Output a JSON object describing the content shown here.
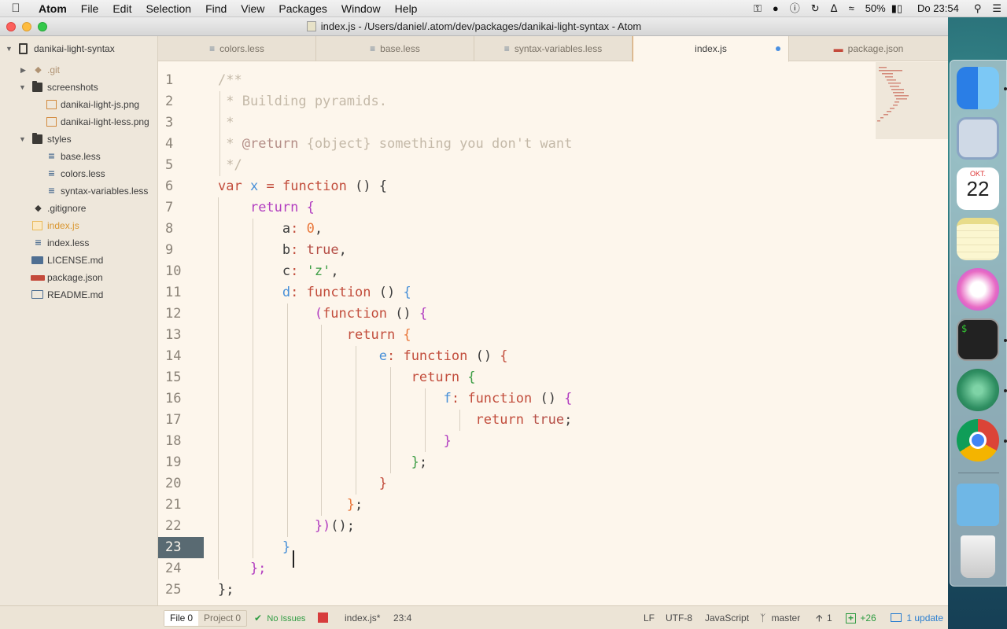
{
  "menubar": {
    "app": "Atom",
    "items": [
      "File",
      "Edit",
      "Selection",
      "Find",
      "View",
      "Packages",
      "Window",
      "Help"
    ],
    "battery": "50%",
    "clock": "Do 23:54"
  },
  "window": {
    "title": "index.js - /Users/daniel/.atom/dev/packages/danikai-light-syntax - Atom"
  },
  "tree": {
    "root": "danikai-light-syntax",
    "items": [
      {
        "label": ".git",
        "type": "folder-git",
        "depth": 1,
        "expanded": false
      },
      {
        "label": "screenshots",
        "type": "folder",
        "depth": 1,
        "expanded": true
      },
      {
        "label": "danikai-light-js.png",
        "type": "image",
        "depth": 2
      },
      {
        "label": "danikai-light-less.png",
        "type": "image",
        "depth": 2
      },
      {
        "label": "styles",
        "type": "folder",
        "depth": 1,
        "expanded": true
      },
      {
        "label": "base.less",
        "type": "less",
        "depth": 2
      },
      {
        "label": "colors.less",
        "type": "less",
        "depth": 2
      },
      {
        "label": "syntax-variables.less",
        "type": "less",
        "depth": 2
      },
      {
        "label": ".gitignore",
        "type": "git",
        "depth": 1
      },
      {
        "label": "index.js",
        "type": "js",
        "depth": 1,
        "highlight": true
      },
      {
        "label": "index.less",
        "type": "less",
        "depth": 1
      },
      {
        "label": "LICENSE.md",
        "type": "md",
        "depth": 1
      },
      {
        "label": "package.json",
        "type": "npm",
        "depth": 1
      },
      {
        "label": "README.md",
        "type": "book",
        "depth": 1
      }
    ]
  },
  "tabs": [
    {
      "label": "colors.less",
      "icon": "less"
    },
    {
      "label": "base.less",
      "icon": "less"
    },
    {
      "label": "syntax-variables.less",
      "icon": "less"
    },
    {
      "label": "index.js",
      "icon": "js",
      "active": true,
      "modified": true
    },
    {
      "label": "package.json",
      "icon": "npm"
    }
  ],
  "editor": {
    "current_line": 23,
    "line_numbers": [
      "1",
      "2",
      "3",
      "4",
      "5",
      "6",
      "7",
      "8",
      "9",
      "10",
      "11",
      "12",
      "13",
      "14",
      "15",
      "16",
      "17",
      "18",
      "19",
      "20",
      "21",
      "22",
      "23",
      "24",
      "25"
    ],
    "lines": [
      [
        {
          "t": "/**",
          "c": "comment"
        }
      ],
      [
        {
          "t": " * Building pyramids.",
          "c": "comment"
        }
      ],
      [
        {
          "t": " *",
          "c": "comment"
        }
      ],
      [
        {
          "t": " * ",
          "c": "comment"
        },
        {
          "t": "@return",
          "c": "doc"
        },
        {
          "t": " {object} something you don't want",
          "c": "comment"
        }
      ],
      [
        {
          "t": " */",
          "c": "comment"
        }
      ],
      [
        {
          "t": "var",
          "c": "kw"
        },
        {
          "t": " ",
          "c": ""
        },
        {
          "t": "x",
          "c": "var"
        },
        {
          "t": " ",
          "c": ""
        },
        {
          "t": "=",
          "c": "op"
        },
        {
          "t": " ",
          "c": ""
        },
        {
          "t": "function",
          "c": "kw"
        },
        {
          "t": " () {",
          "c": ""
        }
      ],
      [
        {
          "t": "    ",
          "c": ""
        },
        {
          "t": "return",
          "c": "ret"
        },
        {
          "t": " {",
          "c": "ret"
        }
      ],
      [
        {
          "t": "        a",
          "c": ""
        },
        {
          "t": ":",
          "c": "op"
        },
        {
          "t": " ",
          "c": ""
        },
        {
          "t": "0",
          "c": "num"
        },
        {
          "t": ",",
          "c": ""
        }
      ],
      [
        {
          "t": "        b",
          "c": ""
        },
        {
          "t": ":",
          "c": "op"
        },
        {
          "t": " ",
          "c": ""
        },
        {
          "t": "true",
          "c": "bool"
        },
        {
          "t": ",",
          "c": ""
        }
      ],
      [
        {
          "t": "        c",
          "c": ""
        },
        {
          "t": ":",
          "c": "op"
        },
        {
          "t": " ",
          "c": ""
        },
        {
          "t": "'z'",
          "c": "str"
        },
        {
          "t": ",",
          "c": ""
        }
      ],
      [
        {
          "t": "        ",
          "c": ""
        },
        {
          "t": "d",
          "c": "var"
        },
        {
          "t": ":",
          "c": "op"
        },
        {
          "t": " ",
          "c": ""
        },
        {
          "t": "function",
          "c": "kw"
        },
        {
          "t": " () ",
          "c": ""
        },
        {
          "t": "{",
          "c": "var"
        }
      ],
      [
        {
          "t": "            (",
          "c": "ret"
        },
        {
          "t": "function",
          "c": "kw"
        },
        {
          "t": " () ",
          "c": ""
        },
        {
          "t": "{",
          "c": "ret"
        }
      ],
      [
        {
          "t": "                ",
          "c": ""
        },
        {
          "t": "return",
          "c": "kw"
        },
        {
          "t": " {",
          "c": "num"
        }
      ],
      [
        {
          "t": "                    ",
          "c": ""
        },
        {
          "t": "e",
          "c": "var"
        },
        {
          "t": ":",
          "c": "op"
        },
        {
          "t": " ",
          "c": ""
        },
        {
          "t": "function",
          "c": "kw"
        },
        {
          "t": " () ",
          "c": ""
        },
        {
          "t": "{",
          "c": "kw"
        }
      ],
      [
        {
          "t": "                        ",
          "c": ""
        },
        {
          "t": "return",
          "c": "kw"
        },
        {
          "t": " {",
          "c": "str"
        }
      ],
      [
        {
          "t": "                            ",
          "c": ""
        },
        {
          "t": "f",
          "c": "var"
        },
        {
          "t": ":",
          "c": "op"
        },
        {
          "t": " ",
          "c": ""
        },
        {
          "t": "function",
          "c": "kw"
        },
        {
          "t": " () ",
          "c": ""
        },
        {
          "t": "{",
          "c": "ret"
        }
      ],
      [
        {
          "t": "                                ",
          "c": ""
        },
        {
          "t": "return",
          "c": "kw"
        },
        {
          "t": " ",
          "c": ""
        },
        {
          "t": "true",
          "c": "bool"
        },
        {
          "t": ";",
          "c": ""
        }
      ],
      [
        {
          "t": "                            }",
          "c": "ret"
        }
      ],
      [
        {
          "t": "                        }",
          "c": "str"
        },
        {
          "t": ";",
          "c": ""
        }
      ],
      [
        {
          "t": "                    }",
          "c": "kw"
        }
      ],
      [
        {
          "t": "                }",
          "c": "num"
        },
        {
          "t": ";",
          "c": ""
        }
      ],
      [
        {
          "t": "            })",
          "c": "ret"
        },
        {
          "t": "();",
          "c": ""
        }
      ],
      [
        {
          "t": "        }",
          "c": "var"
        }
      ],
      [
        {
          "t": "    };",
          "c": "ret"
        }
      ],
      [
        {
          "t": "};",
          "c": ""
        }
      ]
    ]
  },
  "statusbar": {
    "file_tab": "File",
    "file_count": "0",
    "project_tab": "Project",
    "project_count": "0",
    "no_issues": "No Issues",
    "file_name": "index.js*",
    "cursor_pos": "23:4",
    "line_ending": "LF",
    "encoding": "UTF-8",
    "grammar": "JavaScript",
    "branch": "master",
    "ahead": "1",
    "additions": "+26",
    "updates": "1 update"
  },
  "dock": {
    "calendar_month": "OKT.",
    "calendar_day": "22"
  },
  "colors": {
    "editor_bg": "#fdf6ec",
    "tree_bg": "#eee7db",
    "keyword": "#c24d3c",
    "accent_blue": "#4a90e2"
  }
}
